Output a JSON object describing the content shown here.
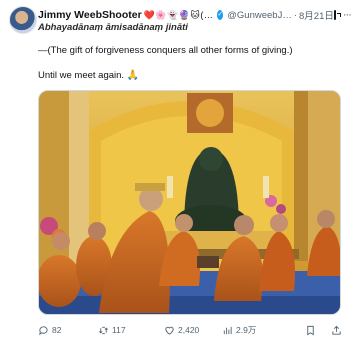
{
  "tweet": {
    "author_name": "Jimmy WeebShooter",
    "author_emojis": "❤️🌸👻🔮🐱(…",
    "handle": "@GunweebJ…",
    "separator": "·",
    "date": "8月21日",
    "more_label": "···",
    "line1": "Abhayadānaṃ āmisadānaṃ jināti",
    "line2": "—(The gift of forgiveness conquers all other forms of giving.)",
    "line3": "Until we meet again. ",
    "line3_emoji": "🙏"
  },
  "actions": {
    "replies": "82",
    "retweets": "117",
    "likes": "2,420",
    "views": "2.9万"
  },
  "colors": {
    "verified": "#1d9bf0",
    "meta_gray": "#536471",
    "robe_orange": "#c8661f",
    "temple_gold": "#d9a93a"
  },
  "icons": {
    "verified": "verified-badge-icon",
    "grok": "grok-icon",
    "more": "more-icon",
    "reply": "reply-icon",
    "retweet": "retweet-icon",
    "like": "heart-icon",
    "views": "views-chart-icon",
    "bookmark": "bookmark-icon",
    "share": "share-icon"
  }
}
